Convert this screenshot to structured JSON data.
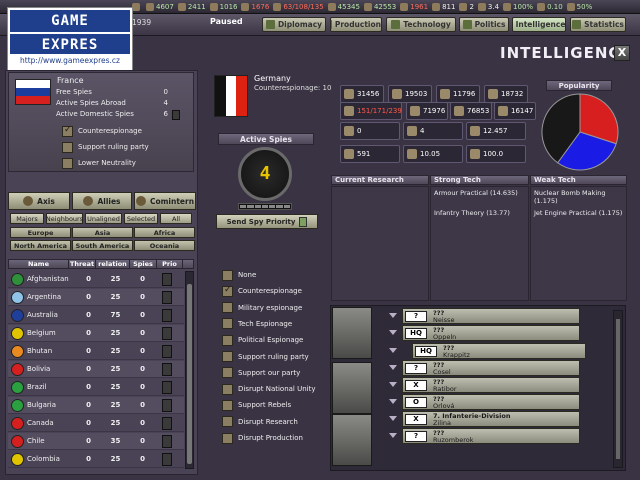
{
  "topbar": {
    "resources": [
      {
        "icon": "flag-icon",
        "value": "",
        "cls": "wht"
      },
      {
        "icon": "energy-icon",
        "value": "4607",
        "cls": ""
      },
      {
        "icon": "metal-icon",
        "value": "2411",
        "cls": ""
      },
      {
        "icon": "rare-icon",
        "value": "1016",
        "cls": ""
      },
      {
        "icon": "oil-icon",
        "value": "1676",
        "cls": "red"
      },
      {
        "icon": "supplies-icon",
        "value": "63/108/135",
        "cls": "red"
      },
      {
        "icon": "money-icon",
        "value": "45345",
        "cls": ""
      },
      {
        "icon": "manpower-icon",
        "value": "42553",
        "cls": ""
      },
      {
        "icon": "transport-icon",
        "value": "1961",
        "cls": "red"
      },
      {
        "icon": "people-icon",
        "value": "811",
        "cls": "wht"
      },
      {
        "icon": "diplomat-icon",
        "value": "2",
        "cls": "wht"
      },
      {
        "icon": "leader-icon",
        "value": "3.4",
        "cls": "wht"
      },
      {
        "icon": "stability-icon",
        "value": "100%",
        "cls": ""
      },
      {
        "icon": "dissent-icon",
        "value": "0.10",
        "cls": ""
      },
      {
        "icon": "neutrality-icon",
        "value": "50%",
        "cls": ""
      }
    ]
  },
  "nav": {
    "year": "1939",
    "paused": "Paused",
    "tabs": [
      "Diplomacy",
      "Production",
      "Technology",
      "Politics",
      "Intelligence",
      "Statistics"
    ]
  },
  "logo": {
    "line1": "GAME",
    "line2": "EXPRES",
    "url": "http://www.gameexpres.cz"
  },
  "window": {
    "title": "INTELLIGENCE",
    "close": "X"
  },
  "own": {
    "country": "France",
    "stats": [
      {
        "label": "Free Spies",
        "value": "0"
      },
      {
        "label": "Active Spies Abroad",
        "value": "4"
      },
      {
        "label": "Active Domestic Spies",
        "value": "6"
      }
    ],
    "options": [
      {
        "label": "Counterespionage",
        "checked": true
      },
      {
        "label": "Support ruling party",
        "checked": false
      },
      {
        "label": "Lower Neutrality",
        "checked": false
      }
    ]
  },
  "factions": [
    "Axis",
    "Allies",
    "Comintern"
  ],
  "filters": [
    "Majors",
    "Neighbours",
    "Unaligned",
    "Selected",
    "All"
  ],
  "regions": [
    "Europe",
    "Asia",
    "Africa",
    "North America",
    "South America",
    "Oceania"
  ],
  "table": {
    "headers": [
      "Name",
      "Threat",
      "relation",
      "Spies",
      "Prio"
    ],
    "rows": [
      {
        "name": "Afghanistan",
        "threat": "0",
        "relation": "25",
        "spies": "0",
        "color": "#2f8f3a"
      },
      {
        "name": "Argentina",
        "threat": "0",
        "relation": "25",
        "spies": "0",
        "color": "#8fc4e8"
      },
      {
        "name": "Australia",
        "threat": "0",
        "relation": "75",
        "spies": "0",
        "color": "#1f3f9c"
      },
      {
        "name": "Belgium",
        "threat": "0",
        "relation": "25",
        "spies": "0",
        "color": "#e0c400"
      },
      {
        "name": "Bhutan",
        "threat": "0",
        "relation": "25",
        "spies": "0",
        "color": "#e88a20"
      },
      {
        "name": "Bolivia",
        "threat": "0",
        "relation": "25",
        "spies": "0",
        "color": "#d62020"
      },
      {
        "name": "Brazil",
        "threat": "0",
        "relation": "25",
        "spies": "0",
        "color": "#2aa040"
      },
      {
        "name": "Bulgaria",
        "threat": "0",
        "relation": "25",
        "spies": "0",
        "color": "#2aa040"
      },
      {
        "name": "Canada",
        "threat": "0",
        "relation": "25",
        "spies": "0",
        "color": "#d62020"
      },
      {
        "name": "Chile",
        "threat": "0",
        "relation": "35",
        "spies": "0",
        "color": "#d62020"
      },
      {
        "name": "Colombia",
        "threat": "0",
        "relation": "25",
        "spies": "0",
        "color": "#e0c400"
      }
    ]
  },
  "target": {
    "country": "Germany",
    "counterespionage": "Counterespionage: 10",
    "active_spies_title": "Active Spies",
    "active_spies": "4",
    "send_button": "Send Spy Priority"
  },
  "missions": [
    {
      "label": "None",
      "checked": false
    },
    {
      "label": "Counterespionage",
      "checked": true
    },
    {
      "label": "Military espionage",
      "checked": false
    },
    {
      "label": "Tech Espionage",
      "checked": false
    },
    {
      "label": "Political Espionage",
      "checked": false
    },
    {
      "label": "Support ruling party",
      "checked": false
    },
    {
      "label": "Support our party",
      "checked": false
    },
    {
      "label": "Disrupt National Unity",
      "checked": false
    },
    {
      "label": "Support Rebels",
      "checked": false
    },
    {
      "label": "Disrupt Research",
      "checked": false
    },
    {
      "label": "Disrupt Production",
      "checked": false
    }
  ],
  "stats": {
    "r1": [
      "31456",
      "19503",
      "11796",
      "18732"
    ],
    "r2a": "151/171/239",
    "r2b": [
      "71976",
      "76853",
      "16147"
    ],
    "r3": [
      "0",
      "4",
      "12.457"
    ],
    "r4": [
      "591",
      "10.05",
      "100.0"
    ]
  },
  "popularity": {
    "title": "Popularity",
    "slices": [
      {
        "color": "#d81f1f",
        "value": 30
      },
      {
        "color": "#1b1be6",
        "value": 30
      },
      {
        "color": "#181818",
        "value": 40
      }
    ]
  },
  "research": {
    "headers": [
      "Current Research",
      "Strong Tech",
      "Weak Tech"
    ],
    "strong": [
      "Armour Practical (14.635)",
      "Infantry Theory (13.77)"
    ],
    "weak": [
      "Nuclear Bomb Making (1.175)",
      "Jet Engine Practical (1.175)"
    ]
  },
  "units": [
    {
      "badge": "?",
      "top": "???",
      "bottom": "Neisse"
    },
    {
      "badge": "HQ",
      "top": "???",
      "bottom": "Oppeln"
    },
    {
      "badge": "HQ",
      "top": "???",
      "bottom": "Krappitz"
    },
    {
      "badge": "?",
      "top": "???",
      "bottom": "Cosel"
    },
    {
      "badge": "X",
      "top": "???",
      "bottom": "Ratibor"
    },
    {
      "badge": "O",
      "top": "???",
      "bottom": "Orlová"
    },
    {
      "badge": "X",
      "top": "7. Infanterie-Division",
      "bottom": "Zilina"
    },
    {
      "badge": "?",
      "top": "???",
      "bottom": "Ruzomberok"
    }
  ]
}
